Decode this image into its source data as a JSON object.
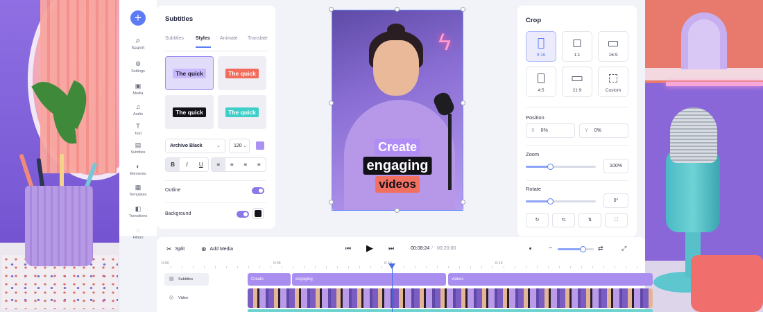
{
  "sidebar": {
    "add_icon": "plus-icon",
    "items": [
      {
        "label": "Search",
        "icon": "search-icon"
      },
      {
        "label": "Settings",
        "icon": "gear-icon"
      },
      {
        "label": "Media",
        "icon": "media-icon"
      },
      {
        "label": "Audio",
        "icon": "music-note-icon"
      },
      {
        "label": "Text",
        "icon": "text-icon"
      },
      {
        "label": "Subtitles",
        "icon": "subtitles-icon"
      },
      {
        "label": "Elements",
        "icon": "elements-icon"
      },
      {
        "label": "Templates",
        "icon": "templates-icon"
      },
      {
        "label": "Transitions",
        "icon": "transitions-icon"
      },
      {
        "label": "Filters",
        "icon": "filters-icon"
      }
    ]
  },
  "subtitles_panel": {
    "title": "Subtitles",
    "tabs": [
      "Subtitles",
      "Styles",
      "Animate",
      "Translate"
    ],
    "active_tab": "Styles",
    "styles": [
      {
        "text": "The quick",
        "bg": "#c9b8fb",
        "color": "#1b1b2b"
      },
      {
        "text": "The quick",
        "bg": "#f26b5b",
        "color": "#ffffff"
      },
      {
        "text": "The quick",
        "bg": "#111118",
        "color": "#ffffff"
      },
      {
        "text": "The quick",
        "bg": "#3fcfc8",
        "color": "#ffffff"
      }
    ],
    "font": "Archivo Black",
    "font_size": "120",
    "text_color": "#a992f2",
    "format_buttons": [
      "B",
      "I",
      "U"
    ],
    "align_buttons": [
      "align-left-icon",
      "align-center-icon",
      "align-right-icon",
      "align-justify-icon"
    ],
    "outline_label": "Outline",
    "outline_on": true,
    "background_label": "Background",
    "background_on": true,
    "background_color": "#15151f"
  },
  "preview": {
    "captions": [
      {
        "text": "Create",
        "bg": "#b08cf5",
        "color": "#ffffff"
      },
      {
        "text": "engaging",
        "bg": "#111118",
        "color": "#ffffff"
      },
      {
        "text": "videos",
        "bg": "#f2705f",
        "color": "#111118"
      }
    ]
  },
  "crop_panel": {
    "title": "Crop",
    "ratios": [
      "9:16",
      "1:1",
      "16:9",
      "4:5",
      "21:9",
      "Custom"
    ],
    "selected_ratio": "9:16",
    "position_label": "Position",
    "x_label": "X",
    "x_value": "0%",
    "y_label": "Y",
    "y_value": "0%",
    "zoom_label": "Zoom",
    "zoom_value": "100%",
    "zoom_level": 0.35,
    "rotate_label": "Rotate",
    "rotate_value": "0°",
    "rotate_level": 0.35,
    "actions": [
      "rotate-icon",
      "flip-horizontal-icon",
      "flip-vertical-icon",
      "reset-crop-icon"
    ]
  },
  "timeline": {
    "split_label": "Split",
    "add_media_label": "Add Media",
    "current_time": "00:08:24",
    "separator": "/",
    "total_time": "00:20:00",
    "volume_level": 0.7,
    "ruler": [
      "0:00",
      "0:05",
      "0:10",
      "0:15"
    ],
    "tracks": [
      {
        "label": "Subtitles",
        "icon": "subtitles-track-icon"
      },
      {
        "label": "Video",
        "icon": "video-track-icon"
      }
    ],
    "subtitle_clips": [
      "Create",
      "engaging",
      "videos"
    ],
    "accent": "#5b7cf5"
  }
}
